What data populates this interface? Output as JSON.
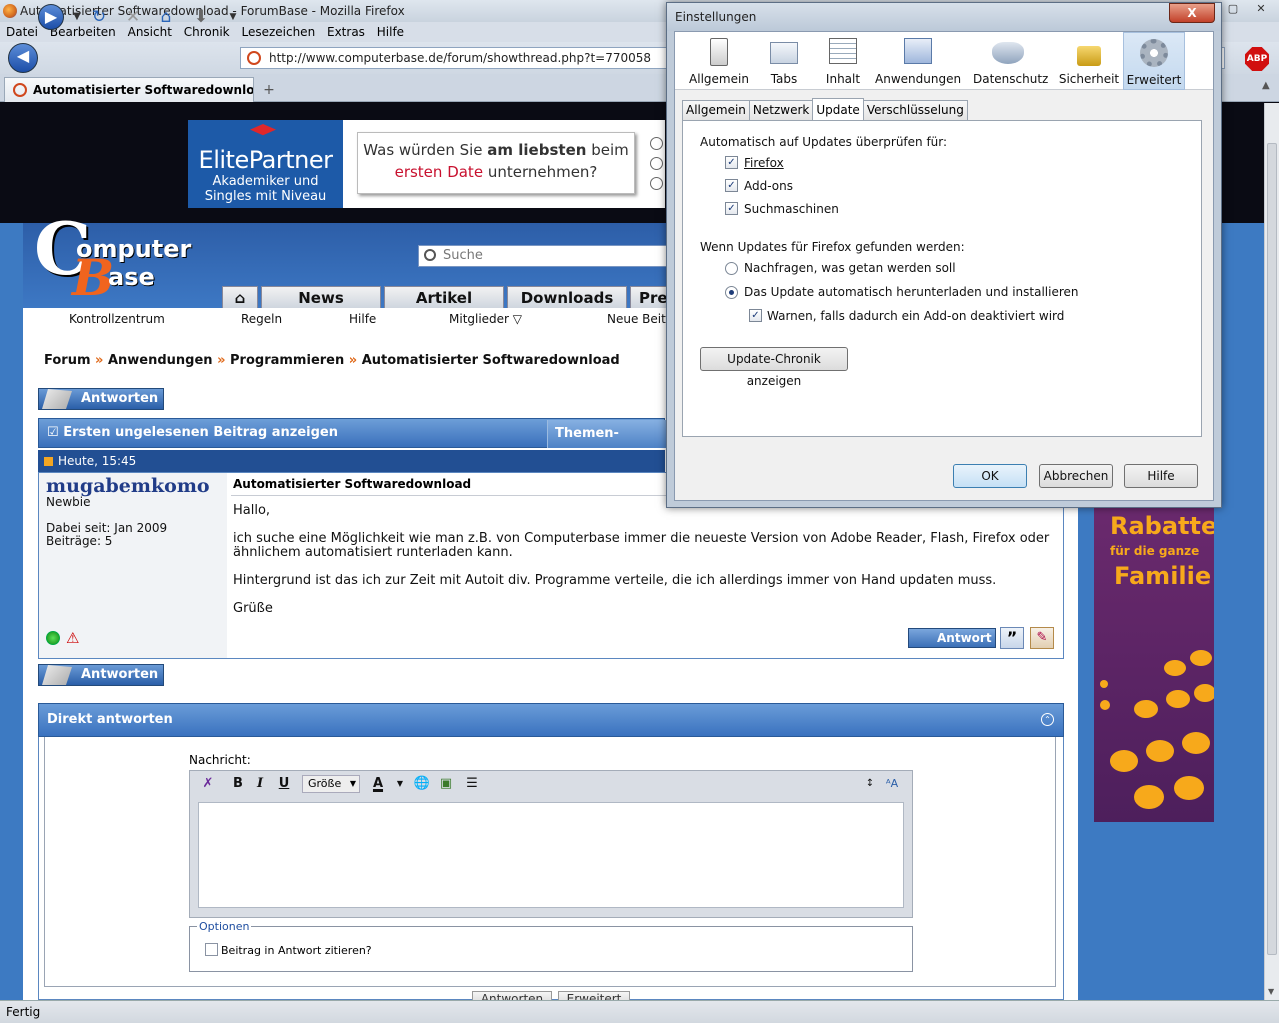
{
  "browser": {
    "title": "Automatisierter Softwaredownload - ForumBase - Mozilla Firefox",
    "menu": [
      "Datei",
      "Bearbeiten",
      "Ansicht",
      "Chronik",
      "Lesezeichen",
      "Extras",
      "Hilfe"
    ],
    "url": "http://www.computerbase.de/forum/showthread.php?t=770058",
    "tab_label": "Automatisierter Softwaredownload -...",
    "new_tab": "+",
    "abp": "ABP",
    "status": "Fertig"
  },
  "page": {
    "ad_elite": {
      "brand": "ElitePartner",
      "line1": "Akademiker und",
      "line2": "Singles mit Niveau"
    },
    "ad_question": {
      "part1": "Was würden Sie ",
      "bold": "am liebsten",
      "part2": " beim",
      "red": "ersten Date",
      "part3": " unternehmen?"
    },
    "logo": {
      "c": "C",
      "omputer": "omputer",
      "b": "B",
      "ase": "ase"
    },
    "search_placeholder": "Suche",
    "nav_tabs": [
      "News",
      "Artikel",
      "Downloads",
      "Pre"
    ],
    "subnav": [
      "Kontrollzentrum",
      "Regeln",
      "Hilfe",
      "Mitglieder ▽",
      "Neue Beit"
    ],
    "breadcrumb": [
      "Forum",
      "Anwendungen",
      "Programmieren",
      "Automatisierter Softwaredownload"
    ],
    "breadcrumb_sep": "»",
    "reply_label": "Antworten",
    "first_unread": "Ersten ungelesenen Beitrag anzeigen",
    "thread_options": "Themen-Optionen",
    "post_date": "Heute, 15:45",
    "post": {
      "username": "mugabemkomo",
      "rank": "Newbie",
      "joined": "Dabei seit: Jan 2009",
      "posts": "Beiträge: 5",
      "title": "Automatisierter Softwaredownload",
      "greeting": "Hallo,",
      "para1a": "ich suche eine Möglichkeit wie man z.B. von Computerbase immer die neueste Version von Adobe Reader, Flash, Firefox oder",
      "para1b": "ähnlichem automatisiert runterladen kann.",
      "para2": "Hintergrund ist das ich zur Zeit mit Autoit div. Programme verteile, die ich allerdings immer von Hand updaten muss.",
      "closing": "Grüße",
      "answer_btn": "Antwort"
    },
    "direct_reply": "Direkt antworten",
    "message_label": "Nachricht:",
    "size_select": "Größe",
    "options_legend": "Optionen",
    "quote_option": "Beitrag in Antwort zitieren?",
    "submit_btn": "Antworten",
    "advanced_btn": "Erweitert",
    "side_ad": {
      "t1": "Rabatte",
      "t2": "für die ganze",
      "t3": "Familie"
    }
  },
  "dialog": {
    "title": "Einstellungen",
    "close": "X",
    "panes": [
      "Allgemein",
      "Tabs",
      "Inhalt",
      "Anwendungen",
      "Datenschutz",
      "Sicherheit",
      "Erweitert"
    ],
    "subtabs": [
      "Allgemein",
      "Netzwerk",
      "Update",
      "Verschlüsselung"
    ],
    "auto_check_heading": "Automatisch auf Updates überprüfen für:",
    "checks": [
      "Firefox",
      "Add-ons",
      "Suchmaschinen"
    ],
    "found_heading": "Wenn Updates für Firefox gefunden werden:",
    "radio_ask": "Nachfragen, was getan werden soll",
    "radio_auto": "Das Update automatisch herunterladen und installieren",
    "warn_check": "Warnen, falls dadurch ein Add-on deaktiviert wird",
    "history_btn": "Update-Chronik anzeigen",
    "ok": "OK",
    "cancel": "Abbrechen",
    "help": "Hilfe"
  }
}
